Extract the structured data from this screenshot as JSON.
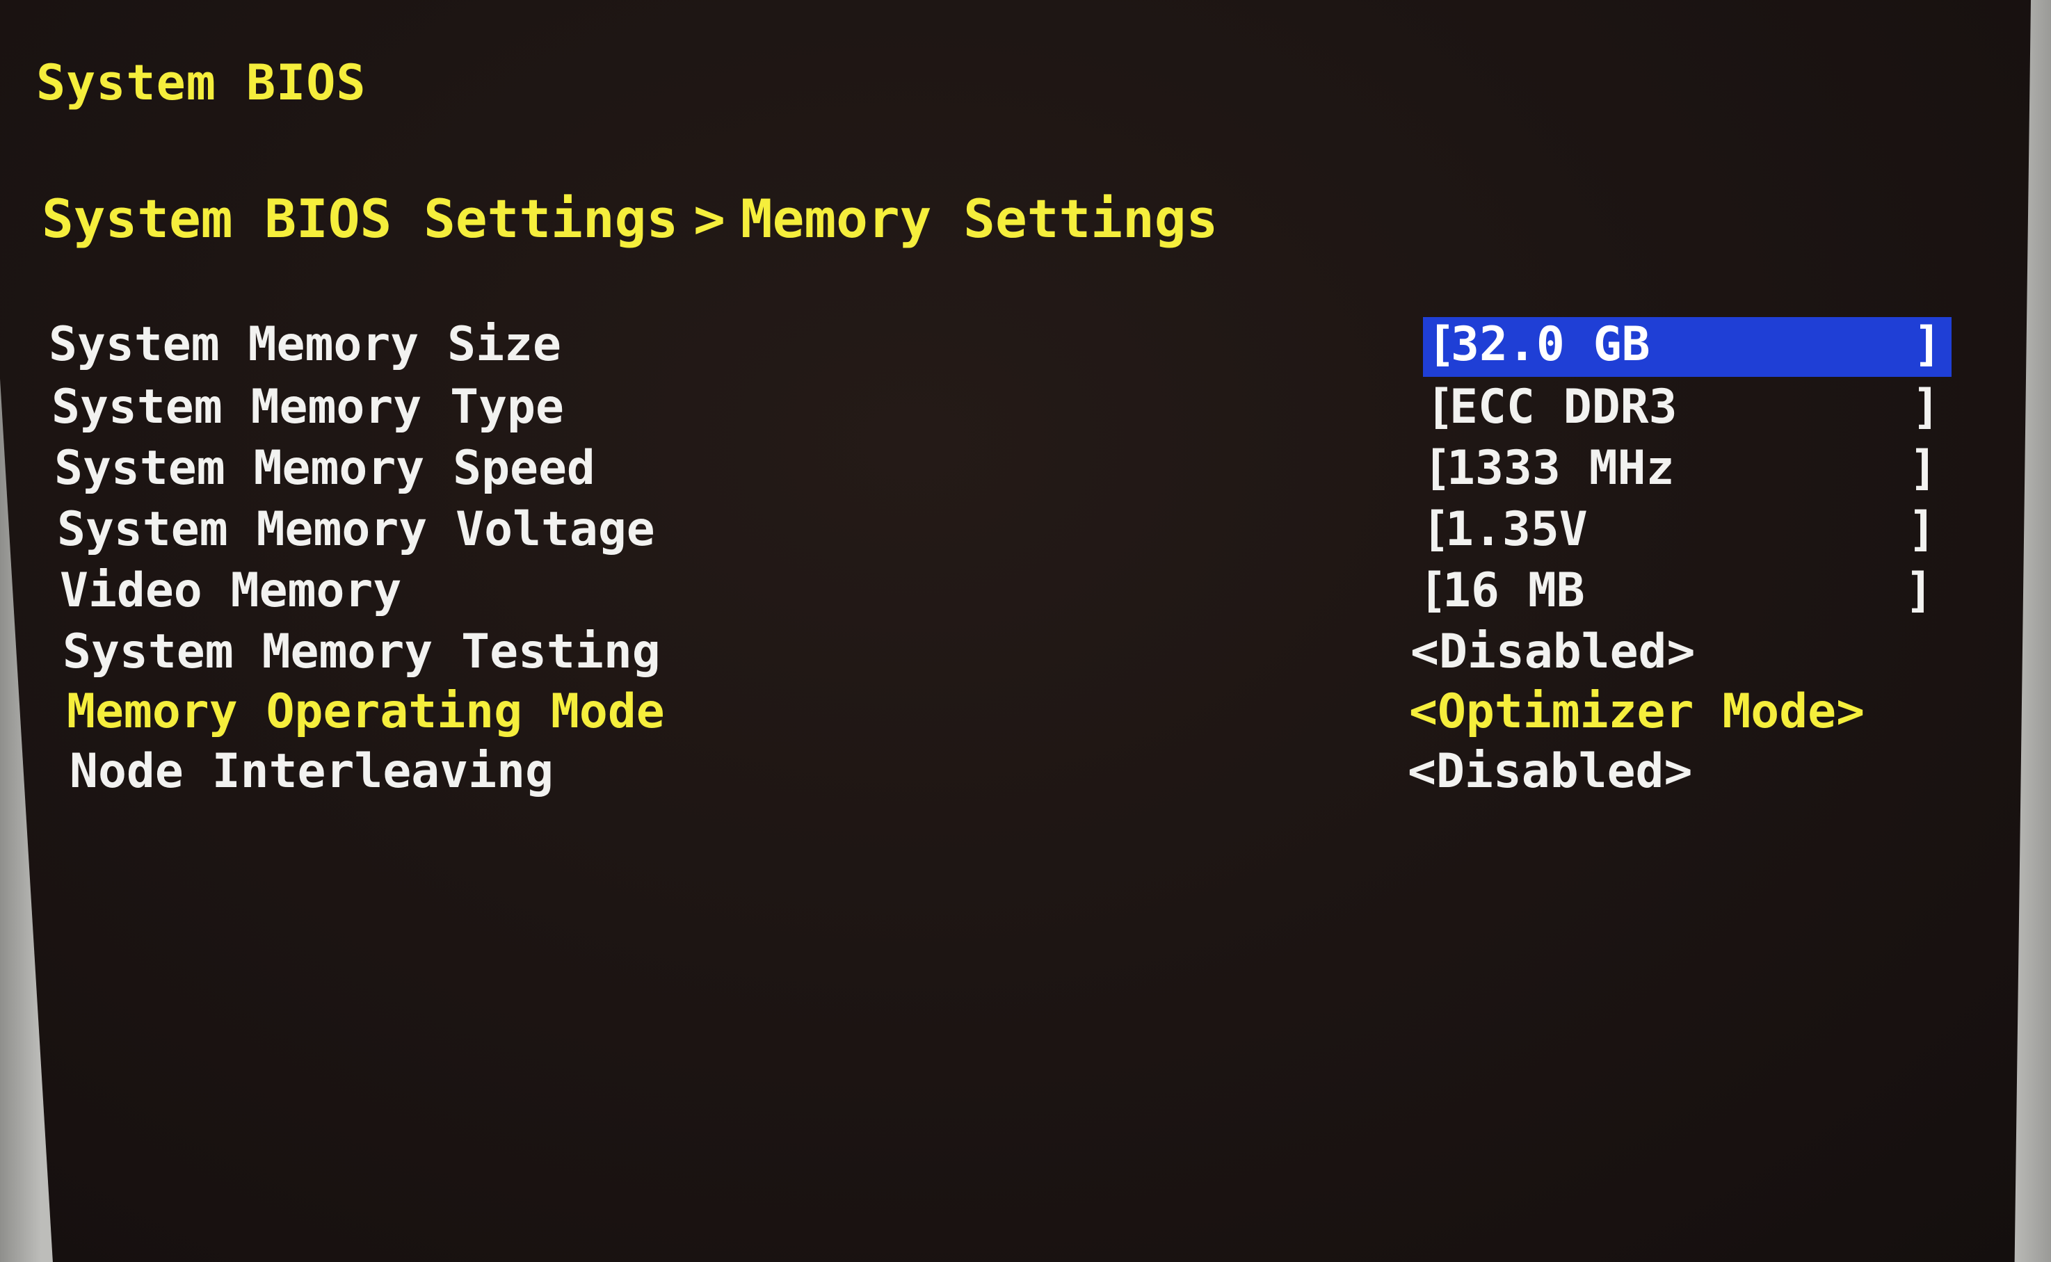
{
  "header": {
    "title": "System BIOS"
  },
  "breadcrumb": {
    "parent": "System BIOS Settings",
    "separator": ">",
    "current": "Memory Settings"
  },
  "settings": [
    {
      "label": "System Memory Size",
      "value": "32.0 GB",
      "style": "bracket",
      "selected": true
    },
    {
      "label": "System Memory Type",
      "value": "ECC DDR3",
      "style": "bracket",
      "selected": false
    },
    {
      "label": "System Memory Speed",
      "value": "1333 MHz",
      "style": "bracket",
      "selected": false
    },
    {
      "label": "System Memory Voltage",
      "value": "1.35V",
      "style": "bracket",
      "selected": false
    },
    {
      "label": "Video Memory",
      "value": "16 MB",
      "style": "bracket",
      "selected": false
    },
    {
      "label": "System Memory Testing",
      "value": "<Disabled>",
      "style": "angle",
      "selected": false
    },
    {
      "label": "Memory Operating Mode",
      "value": "<Optimizer Mode>",
      "style": "angle",
      "selected": false,
      "highlighted": true
    },
    {
      "label": "Node Interleaving",
      "value": "<Disabled>",
      "style": "angle",
      "selected": false
    }
  ],
  "colors": {
    "background": "#1d1513",
    "text": "#f2f2f0",
    "accent_yellow": "#f5ee3c",
    "selection_blue": "#1f3fd6"
  }
}
